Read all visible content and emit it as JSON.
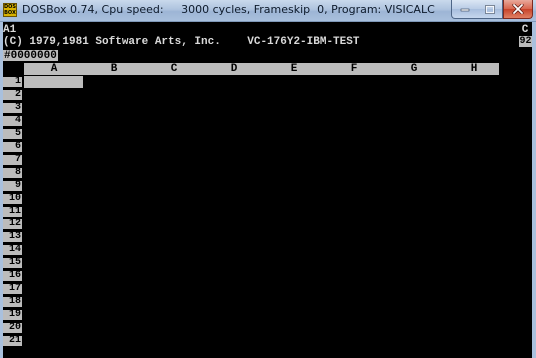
{
  "window": {
    "title": "DOSBox 0.74, Cpu speed:     3000 cycles, Frameskip  0, Program: VISICALC",
    "app_icon_text": "DOS BOX",
    "icons": {
      "app": "dosbox-icon",
      "minimize": "minimize-icon",
      "maximize": "maximize-icon",
      "close": "close-icon"
    }
  },
  "status": {
    "cell_ref": "A1",
    "mode_indicator": "C",
    "memory_indicator": "92"
  },
  "prompt_line": "(C) 1979,1981 Software Arts, Inc.    VC-176Y2-IBM-TEST",
  "command_line": "#0000000",
  "grid": {
    "columns": [
      "A",
      "B",
      "C",
      "D",
      "E",
      "F",
      "G",
      "H"
    ],
    "rows": [
      "1",
      "2",
      "3",
      "4",
      "5",
      "6",
      "7",
      "8",
      "9",
      "10",
      "11",
      "12",
      "13",
      "14",
      "15",
      "16",
      "17",
      "18",
      "19",
      "20",
      "21"
    ],
    "active_cell": "A1"
  },
  "colors": {
    "screen_bg": "#000000",
    "screen_text": "#d9d9d9",
    "header_bg": "#bcbcbc",
    "header_text": "#000000"
  }
}
